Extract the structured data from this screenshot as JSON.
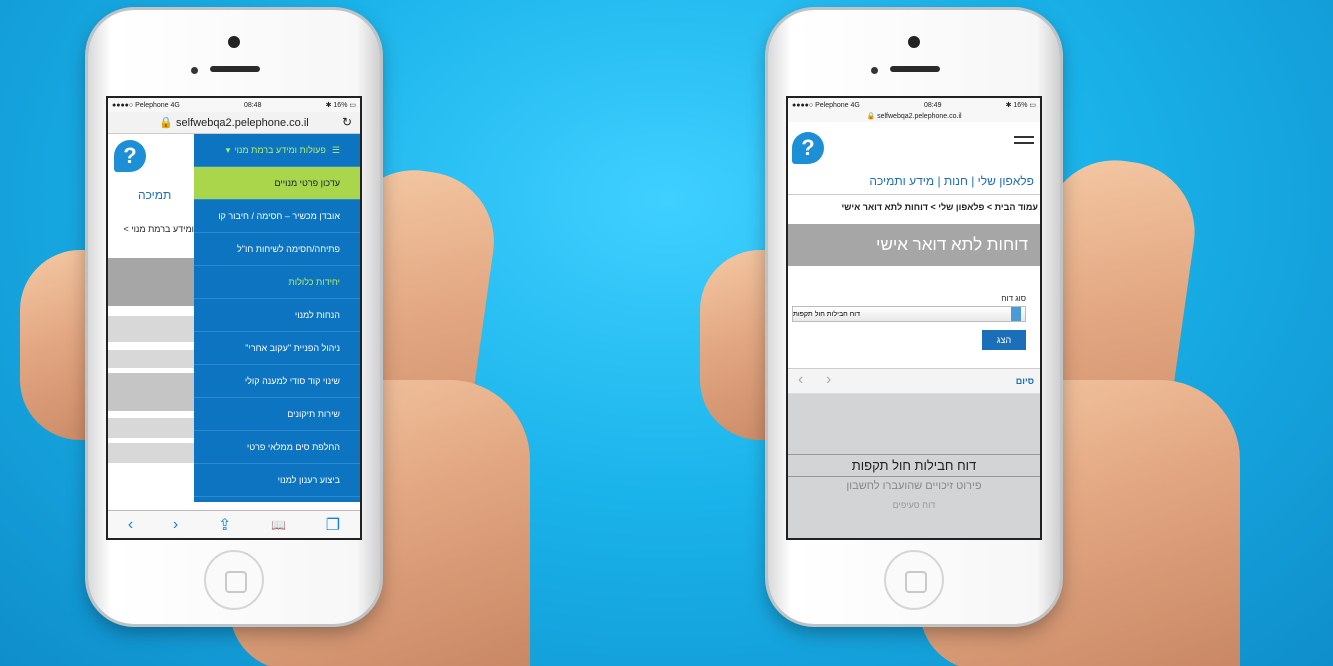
{
  "left_phone": {
    "status": {
      "carrier": "●●●●○ Pelephone  4G",
      "time": "08:48",
      "battery": "✱ 16% ▭"
    },
    "address_bar": {
      "url": "🔒 selfwebqa2.pelephone.co.il",
      "reload": "↻"
    },
    "page_behind": {
      "tab_text": "תמיכה",
      "breadcrumb": "ומידע ברמת מנוי >"
    },
    "menu": {
      "header": "פעולות ומידע ברמת מנוי",
      "items": [
        "עדכון פרטי מנויים",
        "אובדן מכשיר – חסימה / חיבור קו",
        "פתיחה/חסימה לשיחות חו\"ל",
        "יחידות כלולות",
        "הנחות למנוי",
        "ניהול הפניית \"עקוב אחרי\"",
        "שינוי קוד סודי למענה קולי",
        "שירות תיקונים",
        "החלפת סים ממלאי פרטי",
        "ביצוע רענון למנוי"
      ]
    },
    "toolbar": {
      "back": "‹",
      "forward": "›",
      "share": "⇪",
      "bookmarks": "📖",
      "tabs": "❐"
    }
  },
  "right_phone": {
    "status": {
      "carrier": "●●●●○ Pelephone  4G",
      "time": "08:49",
      "battery": "✱ 16% ▭"
    },
    "address_bar": {
      "url": "🔒 selfwebqa2.pelephone.co.il"
    },
    "nav": {
      "text": "פלאפון שלי | חנות | מידע ותמיכה"
    },
    "breadcrumb": {
      "text": "עמוד הבית > פלאפון שלי > דוחות לתא דואר אישי"
    },
    "page_title": "דוחות לתא דואר אישי",
    "form": {
      "label": "סוג דוח",
      "select_value": "דוח חבילות חול תקפות",
      "submit": "הצג"
    },
    "picker": {
      "done": "סיום",
      "prev": "‹",
      "next": "›",
      "options": [
        "דוח חבילות חול תקפות",
        "פירוט זיכויים שהועברו לחשבון",
        "דוח סעיפים"
      ]
    }
  }
}
